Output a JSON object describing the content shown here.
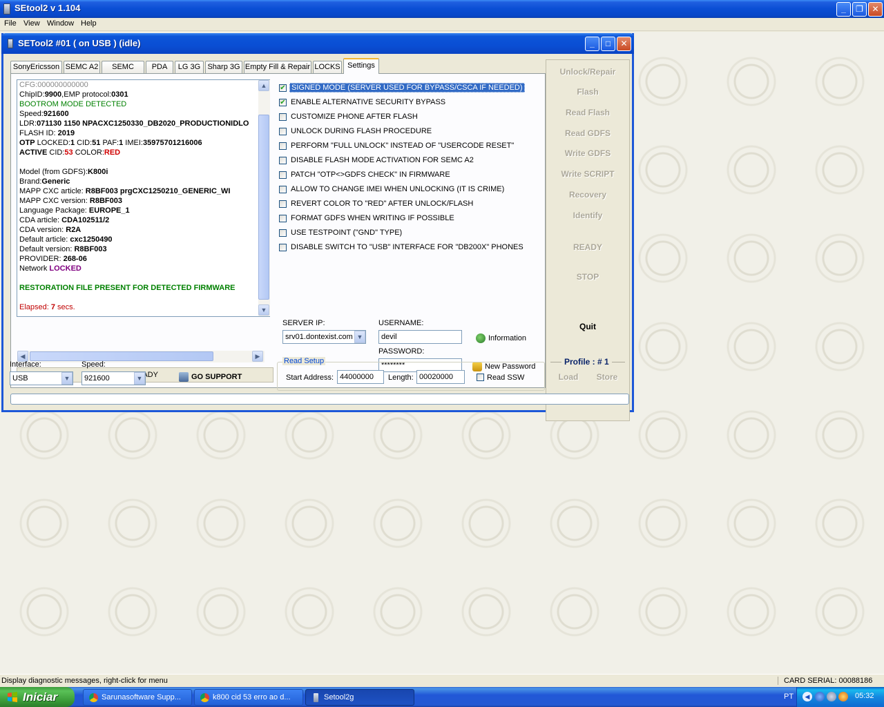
{
  "app": {
    "title": "SEtool2 v 1.104",
    "menu": [
      "File",
      "View",
      "Window",
      "Help"
    ]
  },
  "child": {
    "title": "SETool2 #01 ( on USB ) (idle)"
  },
  "tabs": [
    "SonyEricsson",
    "SEMC A2",
    "SEMC ODM",
    "PDA",
    "LG 3G",
    "Sharp 3G",
    "Empty Fill & Repair",
    "LOCKS",
    "Settings"
  ],
  "active_tab": "Settings",
  "log": {
    "lines": [
      [
        {
          "t": "CFG:000000000000",
          "c": "#888"
        }
      ],
      [
        {
          "t": "ChipID:"
        },
        {
          "t": "9900",
          "b": true
        },
        {
          "t": ",EMP protocol:"
        },
        {
          "t": "0301",
          "b": true
        }
      ],
      [
        {
          "t": "BOOTROM MODE DETECTED",
          "c": "#008000"
        }
      ],
      [
        {
          "t": "Speed:"
        },
        {
          "t": "921600",
          "b": true
        }
      ],
      [
        {
          "t": "LDR:"
        },
        {
          "t": "071130 1150 NPACXC1250330_DB2020_PRODUCTIONIDLO",
          "b": true
        }
      ],
      [
        {
          "t": "FLASH ID: "
        },
        {
          "t": "2019",
          "b": true
        }
      ],
      [
        {
          "t": "OTP",
          "b": true
        },
        {
          "t": " LOCKED:"
        },
        {
          "t": "1",
          "b": true
        },
        {
          "t": " CID:"
        },
        {
          "t": "51",
          "b": true
        },
        {
          "t": " PAF:"
        },
        {
          "t": "1",
          "b": true
        },
        {
          "t": " IMEI:"
        },
        {
          "t": "35975701216006",
          "b": true
        }
      ],
      [
        {
          "t": "ACTIVE",
          "b": true
        },
        {
          "t": " CID:"
        },
        {
          "t": "53",
          "b": true,
          "c": "#d00000"
        },
        {
          "t": " COLOR:"
        },
        {
          "t": "RED",
          "b": true,
          "c": "#d00000"
        }
      ],
      [
        {
          "t": ""
        }
      ],
      [
        {
          "t": "Model (from GDFS):"
        },
        {
          "t": "K800i",
          "b": true
        }
      ],
      [
        {
          "t": "Brand:"
        },
        {
          "t": "Generic",
          "b": true
        }
      ],
      [
        {
          "t": "MAPP CXC article: "
        },
        {
          "t": "R8BF003     prgCXC1250210_GENERIC_WI",
          "b": true
        }
      ],
      [
        {
          "t": "MAPP CXC version: "
        },
        {
          "t": "R8BF003",
          "b": true
        }
      ],
      [
        {
          "t": "Language Package: "
        },
        {
          "t": "EUROPE_1",
          "b": true
        }
      ],
      [
        {
          "t": "CDA article: "
        },
        {
          "t": "CDA102511/2",
          "b": true
        }
      ],
      [
        {
          "t": "CDA version: "
        },
        {
          "t": "R2A",
          "b": true
        }
      ],
      [
        {
          "t": "Default article: "
        },
        {
          "t": "cxc1250490",
          "b": true
        }
      ],
      [
        {
          "t": "Default version: "
        },
        {
          "t": "R8BF003",
          "b": true
        }
      ],
      [
        {
          "t": "PROVIDER: "
        },
        {
          "t": "268-06",
          "b": true
        }
      ],
      [
        {
          "t": "Network "
        },
        {
          "t": "LOCKED",
          "b": true,
          "c": "#800080"
        }
      ],
      [
        {
          "t": ""
        }
      ],
      [
        {
          "t": "RESTORATION FILE PRESENT FOR DETECTED FIRMWARE",
          "b": true,
          "c": "#008000"
        }
      ],
      [
        {
          "t": ""
        }
      ],
      [
        {
          "t": "Elapsed: ",
          "c": "#c00000"
        },
        {
          "t": "7",
          "b": true,
          "c": "#c00000"
        },
        {
          "t": " secs.",
          "c": "#c00000"
        }
      ]
    ],
    "status": "READY"
  },
  "settings": {
    "options": [
      {
        "label": "SIGNED MODE (SERVER USED FOR BYPASS/CSCA IF NEEDED)",
        "checked": true,
        "selected": true
      },
      {
        "label": "ENABLE ALTERNATIVE SECURITY BYPASS",
        "checked": true
      },
      {
        "label": "CUSTOMIZE PHONE AFTER FLASH",
        "checked": false
      },
      {
        "label": "UNLOCK DURING FLASH PROCEDURE",
        "checked": false
      },
      {
        "label": "PERFORM \"FULL UNLOCK\" INSTEAD OF \"USERCODE RESET\"",
        "checked": false
      },
      {
        "label": "DISABLE FLASH MODE ACTIVATION FOR SEMC A2",
        "checked": false
      },
      {
        "label": "PATCH \"OTP<>GDFS CHECK\" IN FIRMWARE",
        "checked": false
      },
      {
        "label": "ALLOW TO CHANGE IMEI WHEN UNLOCKING (IT IS CRIME)",
        "checked": false
      },
      {
        "label": "REVERT COLOR TO \"RED\" AFTER UNLOCK/FLASH",
        "checked": false
      },
      {
        "label": "FORMAT GDFS WHEN WRITING IF POSSIBLE",
        "checked": false
      },
      {
        "label": "USE TESTPOINT (\"GND\" TYPE)",
        "checked": false
      },
      {
        "label": "DISABLE SWITCH TO \"USB\" INTERFACE FOR \"DB200X\" PHONES",
        "checked": false
      }
    ],
    "server_ip_label": "SERVER IP:",
    "server_ip": "srv01.dontexist.com",
    "username_label": "USERNAME:",
    "username": "devil",
    "password_label": "PASSWORD:",
    "password": "********",
    "information_label": "Information",
    "new_password_label": "New Password"
  },
  "actions": {
    "unlock_repair": "Unlock/Repair",
    "flash": "Flash",
    "read_flash": "Read Flash",
    "read_gdfs": "Read GDFS",
    "write_gdfs": "Write GDFS",
    "write_script": "Write SCRIPT",
    "recovery": "Recovery",
    "identify": "Identify",
    "ready": "READY",
    "stop": "STOP",
    "quit": "Quit",
    "profile_label": "Profile :",
    "profile_value": "# 1",
    "load": "Load",
    "store": "Store"
  },
  "bottom": {
    "interface_label": "Interface:",
    "interface_value": "USB",
    "speed_label": "Speed:",
    "speed_value": "921600",
    "go_support": "GO SUPPORT",
    "read_setup_legend": "Read Setup",
    "start_address_label": "Start Address:",
    "start_address": "44000000",
    "length_label": "Length:",
    "length": "00020000",
    "read_ssw_label": "Read SSW"
  },
  "statusbar": {
    "message": "Display diagnostic messages, right-click for menu",
    "card_serial": "CARD SERIAL: 00088186"
  },
  "taskbar": {
    "start": "Iniciar",
    "items": [
      "Sarunasoftware Supp...",
      "k800 cid 53 erro ao d...",
      "Setool2g"
    ],
    "language": "PT",
    "clock": "05:32"
  }
}
